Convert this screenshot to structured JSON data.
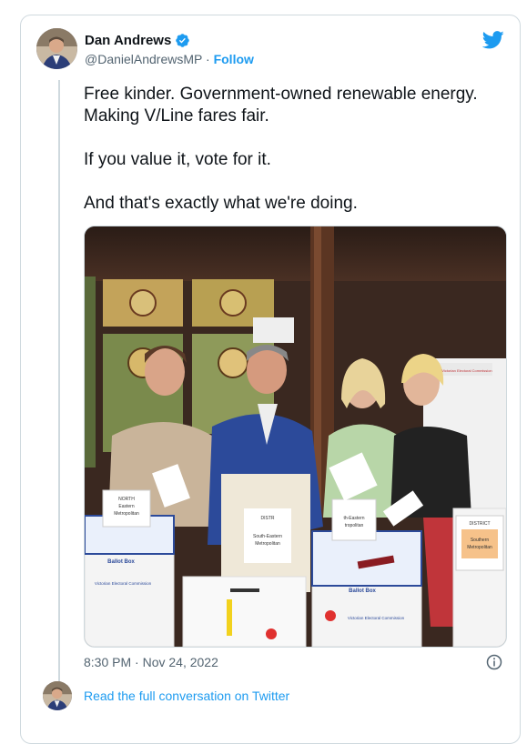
{
  "author": {
    "name": "Dan Andrews",
    "handle": "@DanielAndrewsMP",
    "separator": "·",
    "follow_label": "Follow"
  },
  "tweet": {
    "lines": [
      "Free kinder. Government-owned renewable energy. Making V/Line fares fair.",
      "If you value it, vote for it.",
      "And that's exactly what we're doing."
    ],
    "timestamp": "8:30 PM · Nov 24, 2022"
  },
  "photo": {
    "box_labels": {
      "left_box": [
        "NORTH",
        "Eastern",
        "Metropolitan"
      ],
      "left_box_footer": "Ballot Box",
      "left_box_org": "Victorian Electoral Commission",
      "center_box": [
        "DISTR",
        "South-Eastern",
        "Metropolitan"
      ],
      "center_front_footer": "Ballot Box",
      "center_front_org": "Victorian Electoral Commission",
      "right_box": [
        "DISTRICT",
        "Southern",
        "Metropolitan"
      ],
      "right_center_box": [
        "th-Eastern",
        "tropolitan"
      ],
      "back_box_org": "Victorian Electoral Commission",
      "vec": "VEC"
    }
  },
  "footer": {
    "read_more": "Read the full conversation on Twitter"
  },
  "colors": {
    "link": "#1d9bf0",
    "muted": "#536471",
    "text": "#0f1419",
    "border": "#cfd9de"
  },
  "icons": [
    "verified-badge-icon",
    "twitter-bird-icon",
    "info-icon"
  ]
}
